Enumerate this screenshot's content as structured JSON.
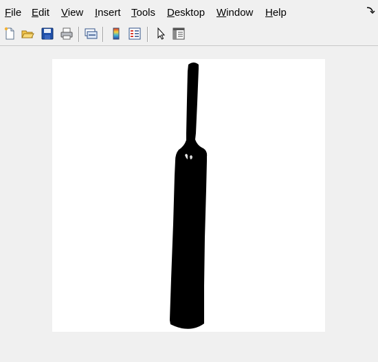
{
  "menu": {
    "file": {
      "mnemonic": "F",
      "rest": "ile"
    },
    "edit": {
      "mnemonic": "E",
      "rest": "dit"
    },
    "view": {
      "mnemonic": "V",
      "rest": "iew"
    },
    "insert": {
      "mnemonic": "I",
      "rest": "nsert"
    },
    "tools": {
      "mnemonic": "T",
      "rest": "ools"
    },
    "desktop": {
      "mnemonic": "D",
      "rest": "esktop"
    },
    "window": {
      "mnemonic": "W",
      "rest": "indow"
    },
    "help": {
      "mnemonic": "H",
      "rest": "elp"
    }
  },
  "toolbar": {
    "icons": [
      "new-figure-icon",
      "open-file-icon",
      "save-icon",
      "print-icon",
      "link-plot-icon",
      "colorbar-icon",
      "legend-icon",
      "edit-plot-arrow-icon",
      "property-inspector-icon"
    ]
  },
  "figure": {
    "background": "#f0f0f0",
    "axes_background": "#ffffff",
    "shape_color": "#000000",
    "image_content": "black silhouette of a cricket bat on white background"
  }
}
